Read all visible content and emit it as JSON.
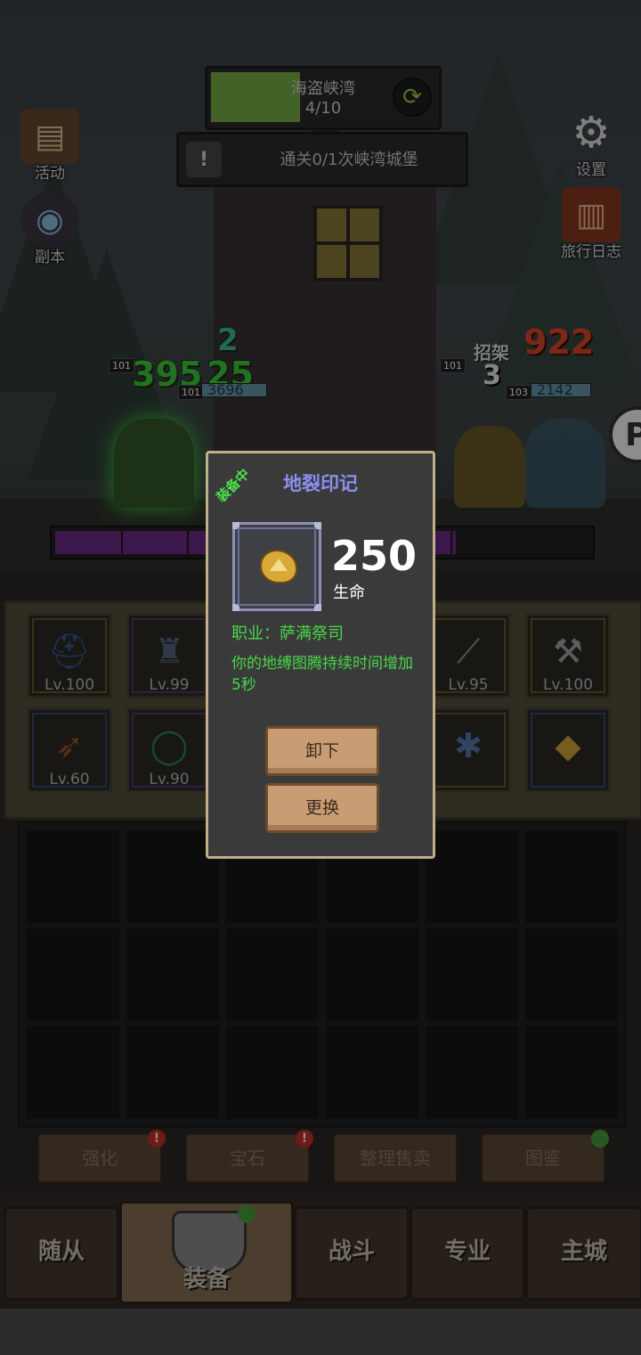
{
  "stage": {
    "name": "海盗峡湾",
    "progress": "4/10",
    "progress_fraction": 0.4
  },
  "task": {
    "text": "通关0/1次峡湾城堡"
  },
  "side_buttons": {
    "activity": "活动",
    "dungeon": "副本",
    "settings": "设置",
    "journal": "旅行日志"
  },
  "battle": {
    "left_damage_1": "395",
    "left_damage_2": "25",
    "left_small": "2",
    "left_hp": "3696",
    "right_damage": "922",
    "right_parry": "招架",
    "right_small": "3",
    "right_hp": "2142",
    "level_tag": "101",
    "level_tag_2": "103",
    "boss_fraction": 0.75
  },
  "equipment": {
    "slots": [
      {
        "lv": "Lv.100",
        "icon": "helmet-icon"
      },
      {
        "lv": "Lv.99",
        "icon": "armor-icon"
      },
      {
        "lv": "",
        "icon": ""
      },
      {
        "lv": "",
        "icon": ""
      },
      {
        "lv": "Lv.95",
        "icon": "spear-icon"
      },
      {
        "lv": "Lv.100",
        "icon": "hammer-icon"
      },
      {
        "lv": "Lv.60",
        "icon": "bow-icon"
      },
      {
        "lv": "Lv.90",
        "icon": "ring-icon"
      },
      {
        "lv": "",
        "icon": ""
      },
      {
        "lv": "",
        "icon": ""
      },
      {
        "lv": "",
        "icon": "claw-icon"
      },
      {
        "lv": "",
        "icon": "stone-icon"
      }
    ]
  },
  "actions": {
    "enhance": "强化",
    "gem": "宝石",
    "sort_sell": "整理售卖",
    "codex": "图鉴",
    "badge": "!"
  },
  "tabs": {
    "followers": "随从",
    "equipment": "装备",
    "battle": "战斗",
    "profession": "专业",
    "main_city": "主城"
  },
  "popup": {
    "equipped_tag": "装备中",
    "title": "地裂印记",
    "stat_value": "250",
    "stat_name": "生命",
    "class_line": "职业：萨满祭司",
    "description": "你的地缚图腾持续时间增加5秒",
    "unequip": "卸下",
    "replace": "更换"
  },
  "colors": {
    "title": "#8b8ff0",
    "green_text": "#48d848",
    "popup_border": "#bfb08a",
    "stage_fill": "#7bb34a",
    "boss_fill": "#6c2a8a"
  }
}
